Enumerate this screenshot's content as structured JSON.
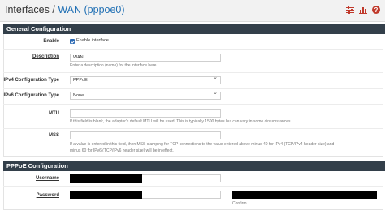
{
  "header": {
    "crumb_root": "Interfaces /",
    "crumb_current": "WAN (pppoe0)",
    "icons": [
      "sliders-icon",
      "bar-chart-icon",
      "help-icon"
    ]
  },
  "general": {
    "title": "General Configuration",
    "enable_label": "Enable",
    "enable_checkbox_text": "Enable interface",
    "enable_checked": true,
    "description_label": "Description",
    "description_value": "WAN",
    "description_help": "Enter a description (name) for the interface here.",
    "ipv4_label": "IPv4 Configuration Type",
    "ipv4_value": "PPPoE",
    "ipv6_label": "IPv6 Configuration Type",
    "ipv6_value": "None",
    "mtu_label": "MTU",
    "mtu_value": "",
    "mtu_help": "If this field is blank, the adapter's default MTU will be used. This is typically 1500 bytes but can vary in some circumstances.",
    "mss_label": "MSS",
    "mss_value": "",
    "mss_help_1": "If a value is entered in this field, then MSS clamping for TCP connections to the value entered above minus 40 for IPv4 (TCP/IPv4 header size) and",
    "mss_help_2": "minus 60 for IPv6 (TCP/IPv6 header size) will be in effect."
  },
  "pppoe": {
    "title": "PPPoE Configuration",
    "username_label": "Username",
    "password_label": "Password",
    "confirm_help": "Confirm"
  }
}
